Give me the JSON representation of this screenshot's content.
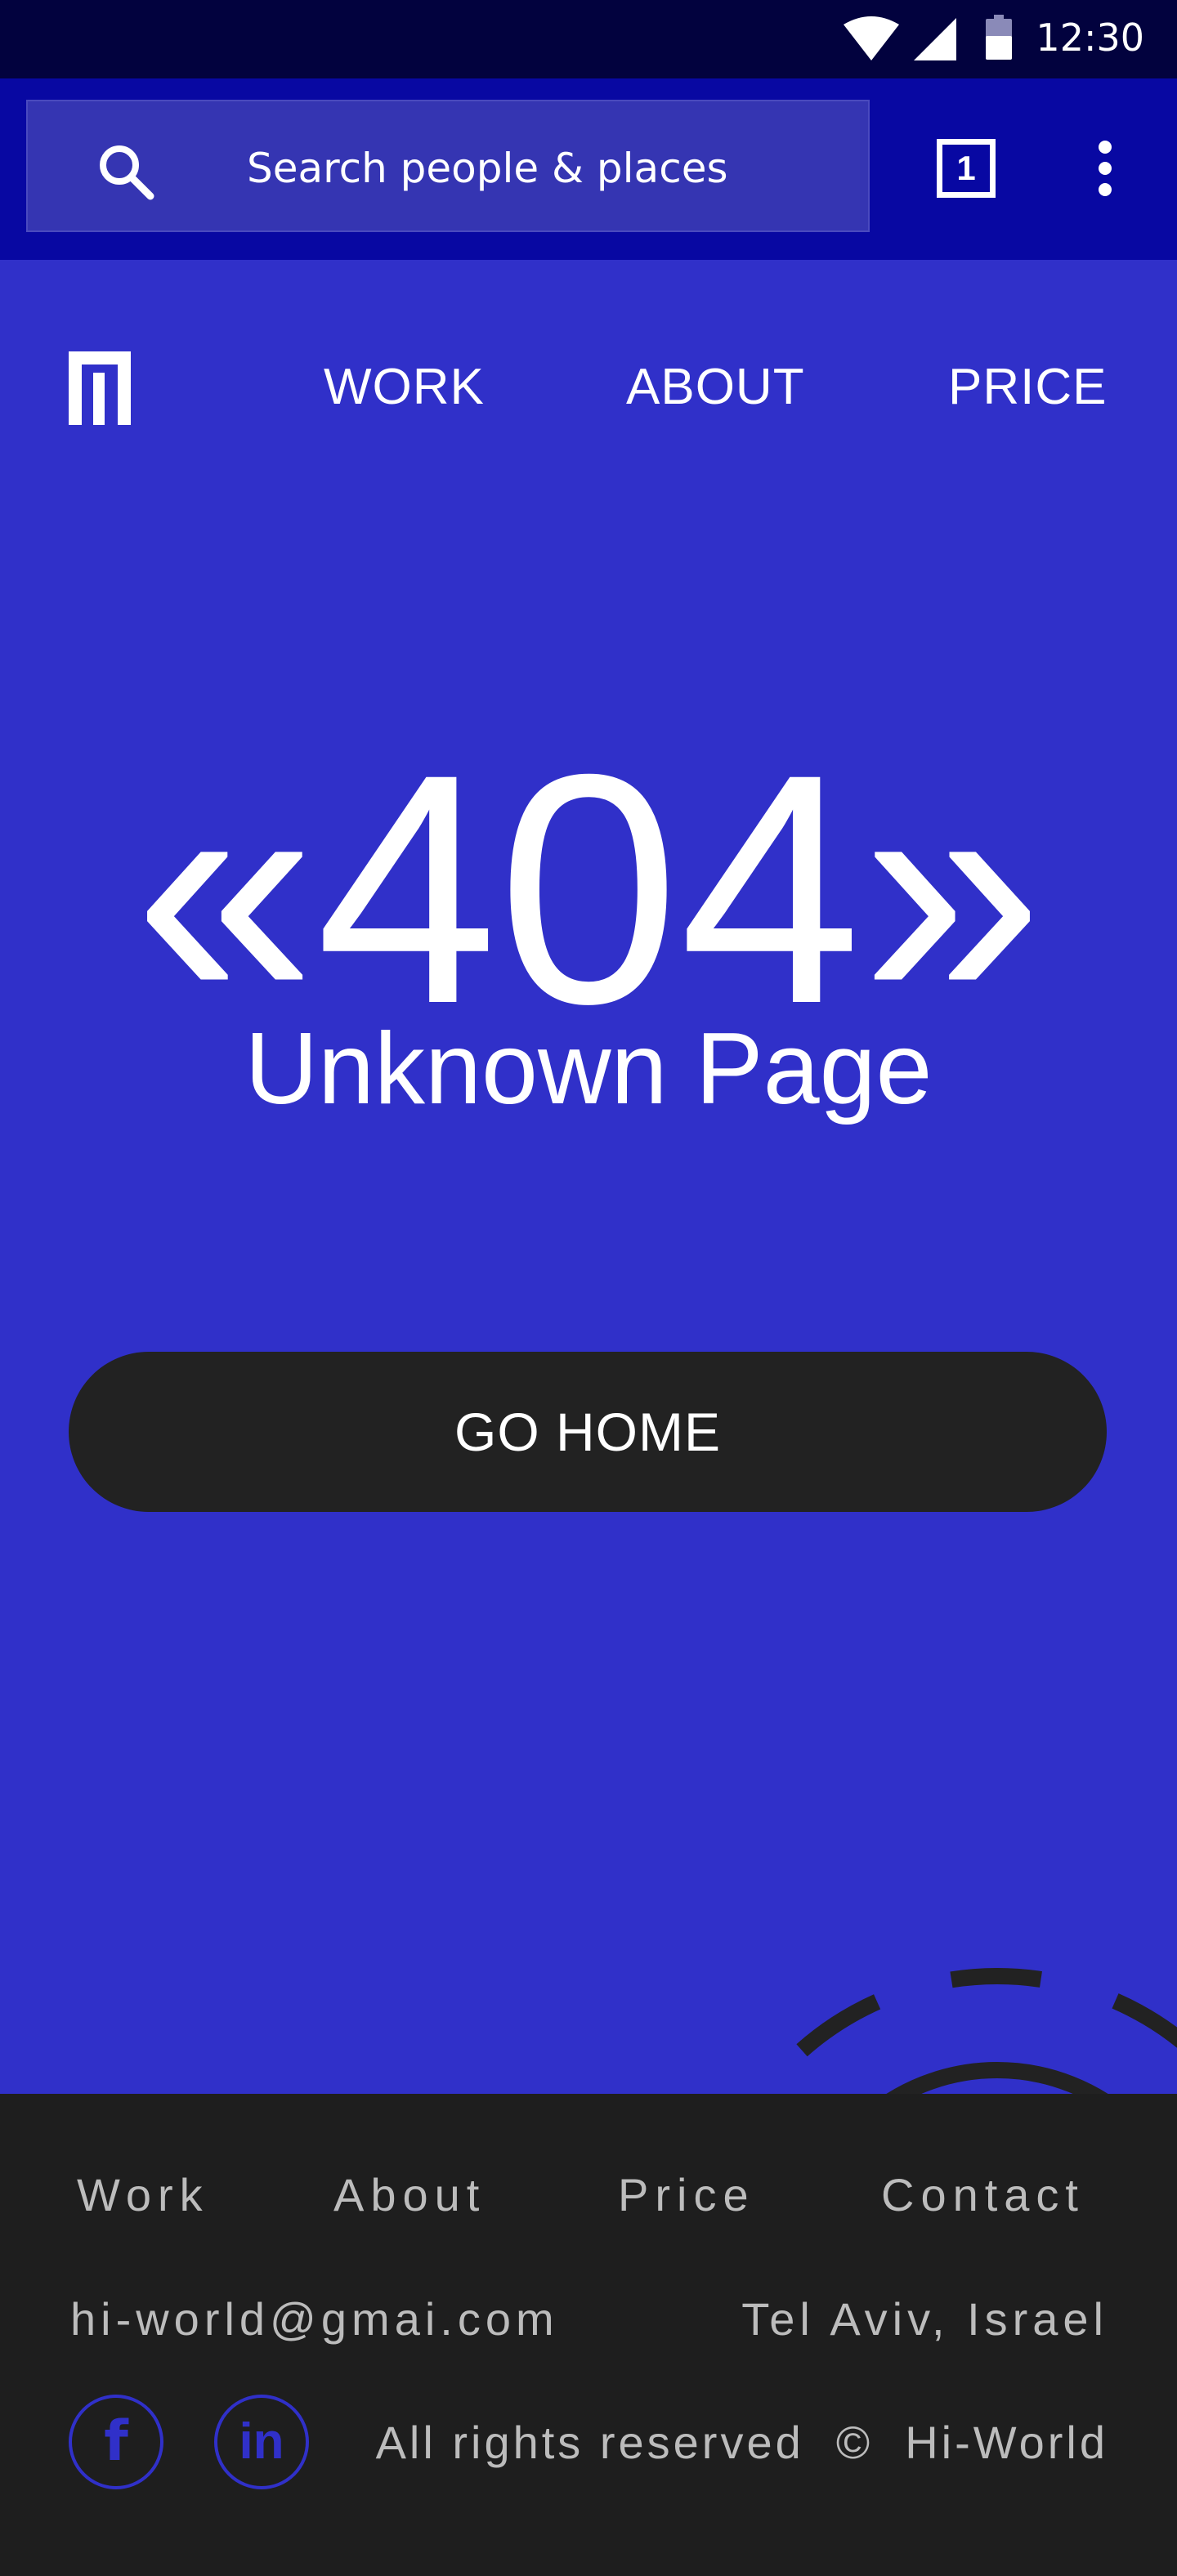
{
  "status_bar": {
    "time": "12:30",
    "icons": [
      "wifi-icon",
      "cellular-signal-icon",
      "battery-icon"
    ]
  },
  "app_bar": {
    "search_placeholder": "Search people & places",
    "tab_count": "1",
    "icons": [
      "search-icon",
      "tabs-icon",
      "overflow-menu-icon"
    ]
  },
  "site_header": {
    "logo_icon": "site-logo-icon",
    "nav": [
      {
        "label": "WORK"
      },
      {
        "label": "ABOUT"
      },
      {
        "label": "PRICE"
      }
    ]
  },
  "error": {
    "code_text": "«404»",
    "message": "Unknown Page"
  },
  "cta": {
    "label": "GO HOME"
  },
  "footer": {
    "links": [
      {
        "label": "Work"
      },
      {
        "label": "About"
      },
      {
        "label": "Price"
      },
      {
        "label": "Contact"
      }
    ],
    "email": "hi-world@gmai.com",
    "location": "Tel Aviv, Israel",
    "social": [
      {
        "label": "f",
        "icon": "facebook-icon"
      },
      {
        "label": "in",
        "icon": "linkedin-icon"
      }
    ],
    "rights": "All rights reserved  ©  Hi-World"
  },
  "colors": {
    "status_bar": "#02023e",
    "app_bar": "#0808a2",
    "hero_background": "#3030c9",
    "button_background": "#222222",
    "footer_background": "#1e1e1e",
    "footer_text": "#bcbcbc"
  }
}
